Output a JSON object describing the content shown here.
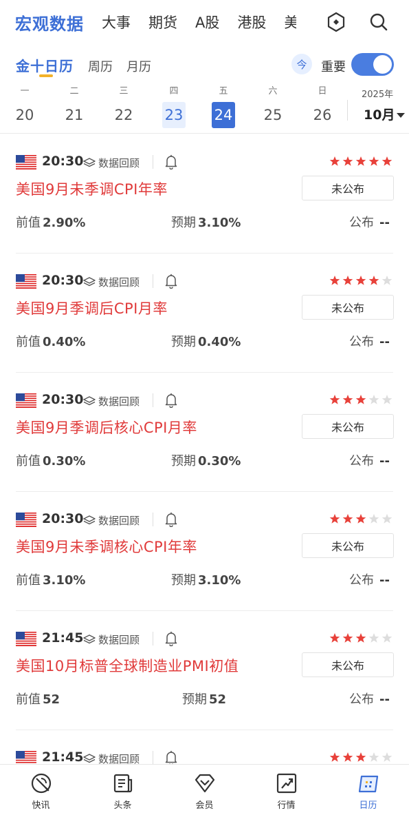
{
  "topnav": {
    "tabs": [
      "宏观数据",
      "大事",
      "期货",
      "A股",
      "港股",
      "美"
    ],
    "icons": [
      "hexagon-icon",
      "search-icon"
    ]
  },
  "subtabs": {
    "items": [
      "金十日历",
      "周历",
      "月历"
    ],
    "today_label": "今",
    "important_label": "重要",
    "important_on": true
  },
  "week": {
    "days": [
      {
        "weekday": "一",
        "date": "20"
      },
      {
        "weekday": "二",
        "date": "21"
      },
      {
        "weekday": "三",
        "date": "22"
      },
      {
        "weekday": "四",
        "date": "23"
      },
      {
        "weekday": "五",
        "date": "24"
      },
      {
        "weekday": "六",
        "date": "25"
      },
      {
        "weekday": "日",
        "date": "26"
      }
    ],
    "today_date": "23",
    "selected_date": "24",
    "year": "2025年",
    "month": "10月"
  },
  "labels": {
    "review": "数据回顾",
    "prev": "前值",
    "forecast": "预期",
    "published": "公布",
    "not_published": "未公布",
    "dash": "--"
  },
  "events": [
    {
      "time": "20:30",
      "country": "us-flag",
      "stars": 5,
      "title": "美国9月未季调CPI年率",
      "status": "未公布",
      "prev": "2.90%",
      "forecast": "3.10%",
      "actual": "--"
    },
    {
      "time": "20:30",
      "country": "us-flag",
      "stars": 4,
      "title": "美国9月季调后CPI月率",
      "status": "未公布",
      "prev": "0.40%",
      "forecast": "0.40%",
      "actual": "--"
    },
    {
      "time": "20:30",
      "country": "us-flag",
      "stars": 3,
      "title": "美国9月季调后核心CPI月率",
      "status": "未公布",
      "prev": "0.30%",
      "forecast": "0.30%",
      "actual": "--"
    },
    {
      "time": "20:30",
      "country": "us-flag",
      "stars": 3,
      "title": "美国9月未季调核心CPI年率",
      "status": "未公布",
      "prev": "3.10%",
      "forecast": "3.10%",
      "actual": "--"
    },
    {
      "time": "21:45",
      "country": "us-flag",
      "stars": 3,
      "title": "美国10月标普全球制造业PMI初值",
      "status": "未公布",
      "prev": "52",
      "forecast": "52",
      "actual": "--"
    },
    {
      "time": "21:45",
      "country": "us-flag",
      "stars": 3,
      "title": "",
      "status": "",
      "prev": "",
      "forecast": "",
      "actual": ""
    }
  ],
  "bottomnav": {
    "items": [
      {
        "label": "快讯",
        "icon": "flash-news-icon"
      },
      {
        "label": "头条",
        "icon": "headline-icon"
      },
      {
        "label": "会员",
        "icon": "vip-diamond-icon"
      },
      {
        "label": "行情",
        "icon": "market-chart-icon"
      },
      {
        "label": "日历",
        "icon": "calendar-icon"
      }
    ],
    "active": "日历"
  },
  "colors": {
    "accent": "#3d6fd6",
    "title_red": "#e03a3a",
    "star_red": "#e8413a",
    "star_gray": "#dddddd",
    "underline": "#f3b22a"
  }
}
